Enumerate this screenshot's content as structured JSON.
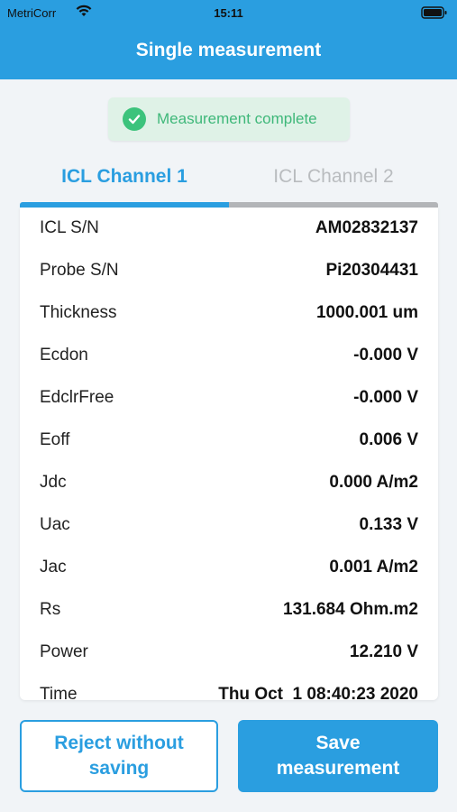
{
  "status_bar": {
    "carrier": "MetriCorr",
    "time": "15:11",
    "wifi_icon": "wifi-icon",
    "battery_icon": "battery-icon"
  },
  "header": {
    "title": "Single measurement",
    "color": "#2a9ee0"
  },
  "toast": {
    "text": "Measurement complete",
    "icon": "check-circle-icon",
    "color": "#3cc37c"
  },
  "tabs": [
    {
      "label": "ICL Channel 1",
      "active": true
    },
    {
      "label": "ICL Channel 2",
      "active": false
    }
  ],
  "measurements": [
    {
      "label": "ICL S/N",
      "value": "AM02832137"
    },
    {
      "label": "Probe S/N",
      "value": "Pi20304431"
    },
    {
      "label": "Thickness",
      "value": "1000.001 um"
    },
    {
      "label": "Ecdon",
      "value": "-0.000 V"
    },
    {
      "label": "EdclrFree",
      "value": "-0.000 V"
    },
    {
      "label": "Eoff",
      "value": "0.006 V"
    },
    {
      "label": "Jdc",
      "value": "0.000 A/m2"
    },
    {
      "label": "Uac",
      "value": "0.133 V"
    },
    {
      "label": "Jac",
      "value": "0.001 A/m2"
    },
    {
      "label": "Rs",
      "value": "131.684 Ohm.m2"
    },
    {
      "label": "Power",
      "value": "12.210 V"
    },
    {
      "label": "Time",
      "value": "Thu Oct  1 08:40:23 2020"
    }
  ],
  "actions": {
    "reject_label": "Reject without saving",
    "save_label": "Save measurement"
  }
}
